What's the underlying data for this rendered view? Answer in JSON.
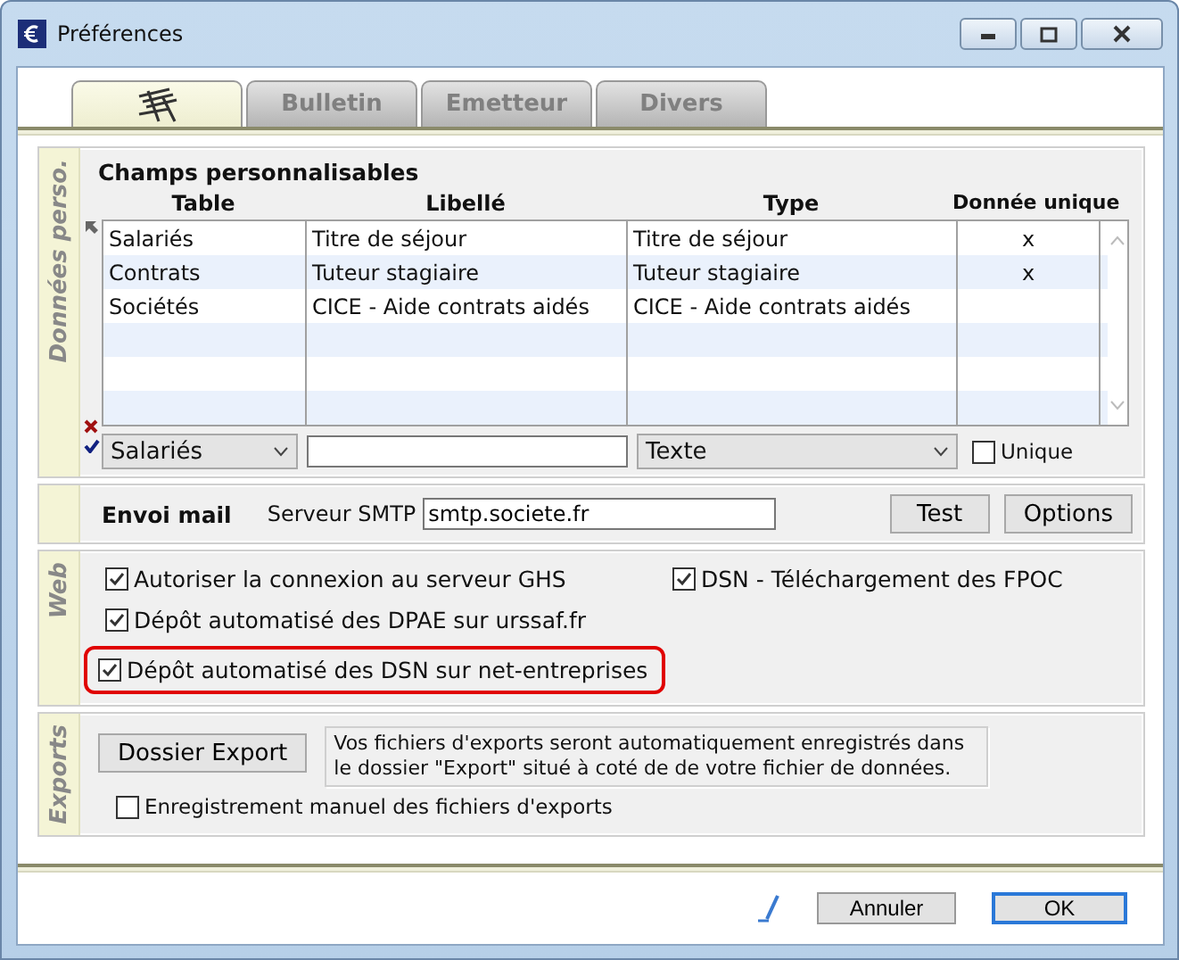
{
  "window": {
    "title": "Préférences"
  },
  "tabs": [
    {
      "kind": "icon",
      "selected": true
    },
    {
      "kind": "text",
      "label": "Bulletin",
      "selected": false
    },
    {
      "kind": "text",
      "label": "Emetteur",
      "selected": false
    },
    {
      "kind": "text",
      "label": "Divers",
      "selected": false
    }
  ],
  "custom_fields": {
    "side_label": "Données perso.",
    "title": "Champs personnalisables",
    "columns": [
      "Table",
      "Libellé",
      "Type",
      "Donnée unique"
    ],
    "rows": [
      {
        "table": "Salariés",
        "label": "Titre de séjour",
        "type": "Titre de séjour",
        "unique": "x"
      },
      {
        "table": "Contrats",
        "label": "Tuteur stagiaire",
        "type": "Tuteur stagiaire",
        "unique": "x"
      },
      {
        "table": "Sociétés",
        "label": "CICE - Aide contrats aidés",
        "type": "CICE - Aide contrats aidés",
        "unique": ""
      }
    ],
    "editor": {
      "table": "Salariés",
      "type": "Texte",
      "unique": {
        "label": "Unique",
        "checked": false
      }
    }
  },
  "mail": {
    "title": "Envoi mail",
    "smtp_label": "Serveur SMTP",
    "smtp_value": "smtp.societe.fr",
    "buttons": [
      "Test",
      "Options"
    ]
  },
  "web": {
    "side_label": "Web",
    "options": [
      {
        "label": "Autoriser la connexion au serveur GHS",
        "checked": true,
        "highlighted": false
      },
      {
        "label": "DSN - Téléchargement des FPOC",
        "checked": true,
        "highlighted": false
      },
      {
        "label": "Dépôt automatisé des DPAE sur urssaf.fr",
        "checked": true,
        "highlighted": false
      },
      {
        "label": "Dépôt automatisé des DSN sur net-entreprises",
        "checked": true,
        "highlighted": true
      }
    ]
  },
  "exports": {
    "side_label": "Exports",
    "button": "Dossier Export",
    "note": "Vos fichiers d'exports seront automatiquement enregistrés dans le dossier \"Export\" situé à coté de de votre fichier de données.",
    "manual": {
      "label": "Enregistrement manuel des fichiers d'exports",
      "checked": false
    }
  },
  "footer": {
    "buttons": [
      {
        "label": "Annuler",
        "default": false
      },
      {
        "label": "OK",
        "default": true
      }
    ]
  }
}
